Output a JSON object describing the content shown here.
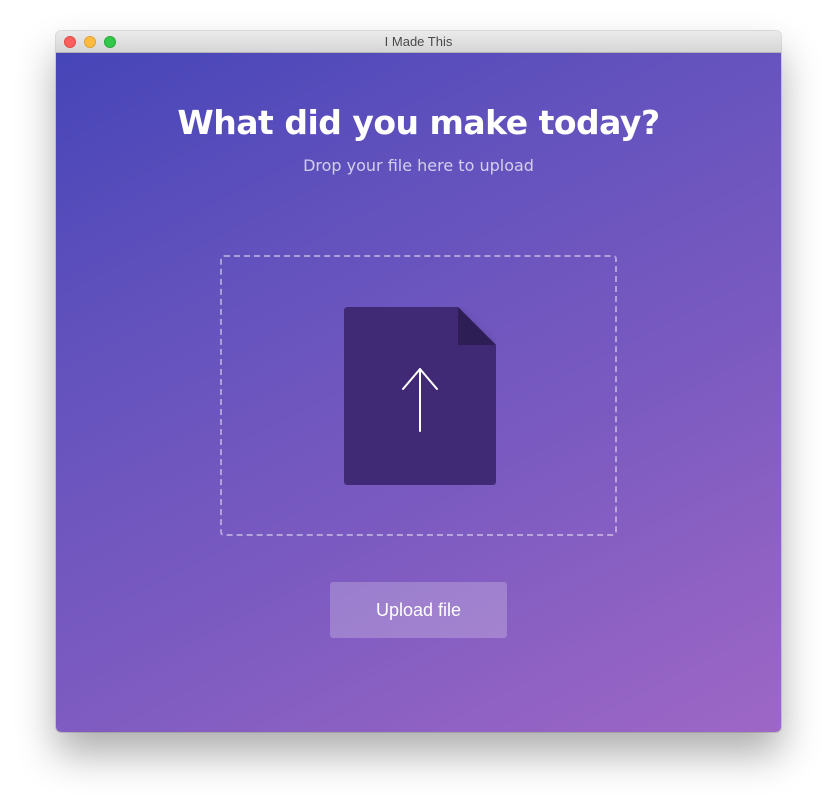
{
  "window": {
    "title": "I Made This",
    "controls": [
      "close",
      "minimize",
      "maximize"
    ]
  },
  "main": {
    "headline": "What did you make today?",
    "subheadline": "Drop your file here to upload",
    "dropzone": {
      "icon": "file-upload-icon"
    },
    "upload_button_label": "Upload file"
  },
  "colors": {
    "gradient_start": "#4645b8",
    "gradient_end": "#9e67c6",
    "file_icon": "#3f2a74",
    "file_icon_fold": "#2e1e56"
  }
}
